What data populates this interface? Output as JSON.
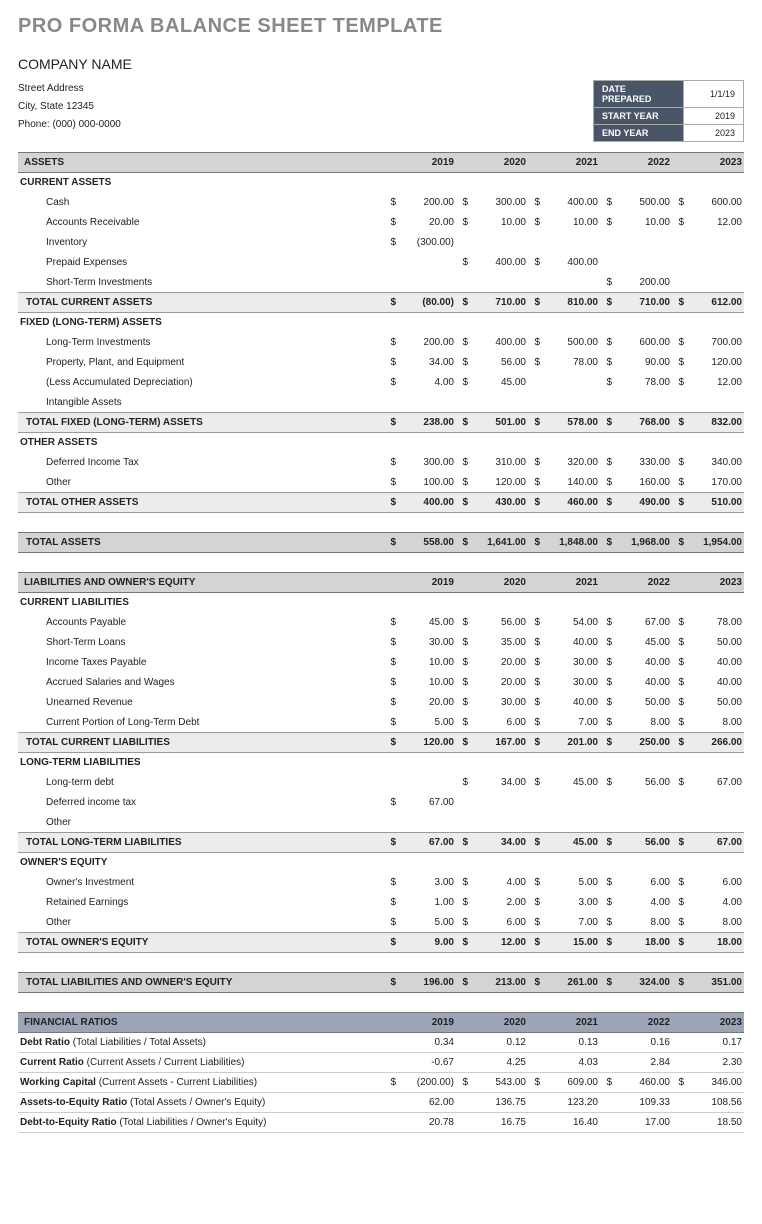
{
  "title": "PRO FORMA BALANCE SHEET TEMPLATE",
  "company": "COMPANY NAME",
  "addr": {
    "street": "Street Address",
    "city": "City, State  12345",
    "phone": "Phone: (000) 000-0000"
  },
  "dates": {
    "prep_lbl": "DATE PREPARED",
    "prep": "1/1/19",
    "sy_lbl": "START YEAR",
    "sy": "2019",
    "ey_lbl": "END YEAR",
    "ey": "2023"
  },
  "years": [
    "2019",
    "2020",
    "2021",
    "2022",
    "2023"
  ],
  "hdrs": {
    "assets": "ASSETS",
    "liab": "LIABILITIES AND OWNER'S EQUITY",
    "fin": "FINANCIAL RATIOS"
  },
  "sects": {
    "ca": "CURRENT ASSETS",
    "fa": "FIXED (LONG-TERM) ASSETS",
    "oa": "OTHER ASSETS",
    "cl": "CURRENT LIABILITIES",
    "ll": "LONG-TERM LIABILITIES",
    "oe": "OWNER'S EQUITY"
  },
  "rows": {
    "cash": {
      "n": "Cash",
      "v": [
        "200.00",
        "300.00",
        "400.00",
        "500.00",
        "600.00"
      ],
      "c": [
        1,
        1,
        1,
        1,
        1
      ]
    },
    "ar": {
      "n": "Accounts Receivable",
      "v": [
        "20.00",
        "10.00",
        "10.00",
        "10.00",
        "12.00"
      ],
      "c": [
        1,
        1,
        1,
        1,
        1
      ]
    },
    "inv": {
      "n": "Inventory",
      "v": [
        "(300.00)",
        "",
        "",
        "",
        ""
      ],
      "c": [
        1,
        0,
        0,
        0,
        0
      ]
    },
    "pre": {
      "n": "Prepaid Expenses",
      "v": [
        "",
        "400.00",
        "400.00",
        "",
        ""
      ],
      "c": [
        0,
        1,
        1,
        0,
        0
      ]
    },
    "sti": {
      "n": "Short-Term Investments",
      "v": [
        "",
        "",
        "",
        "200.00",
        ""
      ],
      "c": [
        0,
        0,
        0,
        1,
        0
      ]
    },
    "tca": {
      "n": "TOTAL CURRENT ASSETS",
      "v": [
        "(80.00)",
        "710.00",
        "810.00",
        "710.00",
        "612.00"
      ],
      "c": [
        1,
        1,
        1,
        1,
        1
      ]
    },
    "lti": {
      "n": "Long-Term Investments",
      "v": [
        "200.00",
        "400.00",
        "500.00",
        "600.00",
        "700.00"
      ],
      "c": [
        1,
        1,
        1,
        1,
        1
      ]
    },
    "ppe": {
      "n": "Property, Plant, and Equipment",
      "v": [
        "34.00",
        "56.00",
        "78.00",
        "90.00",
        "120.00"
      ],
      "c": [
        1,
        1,
        1,
        1,
        1
      ]
    },
    "dep": {
      "n": "(Less Accumulated Depreciation)",
      "v": [
        "4.00",
        "45.00",
        "",
        "78.00",
        "12.00"
      ],
      "c": [
        1,
        1,
        0,
        1,
        1
      ]
    },
    "ia": {
      "n": "Intangible Assets",
      "v": [
        "",
        "",
        "",
        "",
        ""
      ],
      "c": [
        0,
        0,
        0,
        0,
        0
      ]
    },
    "tfa": {
      "n": "TOTAL FIXED (LONG-TERM) ASSETS",
      "v": [
        "238.00",
        "501.00",
        "578.00",
        "768.00",
        "832.00"
      ],
      "c": [
        1,
        1,
        1,
        1,
        1
      ]
    },
    "dit": {
      "n": "Deferred Income Tax",
      "v": [
        "300.00",
        "310.00",
        "320.00",
        "330.00",
        "340.00"
      ],
      "c": [
        1,
        1,
        1,
        1,
        1
      ]
    },
    "oth": {
      "n": "Other",
      "v": [
        "100.00",
        "120.00",
        "140.00",
        "160.00",
        "170.00"
      ],
      "c": [
        1,
        1,
        1,
        1,
        1
      ]
    },
    "toa": {
      "n": "TOTAL OTHER ASSETS",
      "v": [
        "400.00",
        "430.00",
        "460.00",
        "490.00",
        "510.00"
      ],
      "c": [
        1,
        1,
        1,
        1,
        1
      ]
    },
    "ta": {
      "n": "TOTAL ASSETS",
      "v": [
        "558.00",
        "1,641.00",
        "1,848.00",
        "1,968.00",
        "1,954.00"
      ],
      "c": [
        1,
        1,
        1,
        1,
        1
      ]
    },
    "ap": {
      "n": "Accounts Payable",
      "v": [
        "45.00",
        "56.00",
        "54.00",
        "67.00",
        "78.00"
      ],
      "c": [
        1,
        1,
        1,
        1,
        1
      ]
    },
    "stl": {
      "n": "Short-Term Loans",
      "v": [
        "30.00",
        "35.00",
        "40.00",
        "45.00",
        "50.00"
      ],
      "c": [
        1,
        1,
        1,
        1,
        1
      ]
    },
    "itp": {
      "n": "Income Taxes Payable",
      "v": [
        "10.00",
        "20.00",
        "30.00",
        "40.00",
        "40.00"
      ],
      "c": [
        1,
        1,
        1,
        1,
        1
      ]
    },
    "asw": {
      "n": "Accrued Salaries and Wages",
      "v": [
        "10.00",
        "20.00",
        "30.00",
        "40.00",
        "40.00"
      ],
      "c": [
        1,
        1,
        1,
        1,
        1
      ]
    },
    "ur": {
      "n": "Unearned Revenue",
      "v": [
        "20.00",
        "30.00",
        "40.00",
        "50.00",
        "50.00"
      ],
      "c": [
        1,
        1,
        1,
        1,
        1
      ]
    },
    "cpl": {
      "n": "Current Portion of Long-Term Debt",
      "v": [
        "5.00",
        "6.00",
        "7.00",
        "8.00",
        "8.00"
      ],
      "c": [
        1,
        1,
        1,
        1,
        1
      ]
    },
    "tcl": {
      "n": "TOTAL CURRENT LIABILITIES",
      "v": [
        "120.00",
        "167.00",
        "201.00",
        "250.00",
        "266.00"
      ],
      "c": [
        1,
        1,
        1,
        1,
        1
      ]
    },
    "ltd": {
      "n": "Long-term debt",
      "v": [
        "",
        "34.00",
        "45.00",
        "56.00",
        "67.00"
      ],
      "c": [
        0,
        1,
        1,
        1,
        1
      ]
    },
    "dit2": {
      "n": "Deferred income tax",
      "v": [
        "67.00",
        "",
        "",
        "",
        ""
      ],
      "c": [
        1,
        0,
        0,
        0,
        0
      ]
    },
    "oth2": {
      "n": "Other",
      "v": [
        "",
        "",
        "",
        "",
        ""
      ],
      "c": [
        0,
        0,
        0,
        0,
        0
      ]
    },
    "tll": {
      "n": "TOTAL LONG-TERM LIABILITIES",
      "v": [
        "67.00",
        "34.00",
        "45.00",
        "56.00",
        "67.00"
      ],
      "c": [
        1,
        1,
        1,
        1,
        1
      ]
    },
    "oi": {
      "n": "Owner's Investment",
      "v": [
        "3.00",
        "4.00",
        "5.00",
        "6.00",
        "6.00"
      ],
      "c": [
        1,
        1,
        1,
        1,
        1
      ]
    },
    "re": {
      "n": "Retained Earnings",
      "v": [
        "1.00",
        "2.00",
        "3.00",
        "4.00",
        "4.00"
      ],
      "c": [
        1,
        1,
        1,
        1,
        1
      ]
    },
    "oth3": {
      "n": "Other",
      "v": [
        "5.00",
        "6.00",
        "7.00",
        "8.00",
        "8.00"
      ],
      "c": [
        1,
        1,
        1,
        1,
        1
      ]
    },
    "toe": {
      "n": "TOTAL OWNER'S EQUITY",
      "v": [
        "9.00",
        "12.00",
        "15.00",
        "18.00",
        "18.00"
      ],
      "c": [
        1,
        1,
        1,
        1,
        1
      ]
    },
    "tloe": {
      "n": "TOTAL LIABILITIES AND OWNER'S EQUITY",
      "v": [
        "196.00",
        "213.00",
        "261.00",
        "324.00",
        "351.00"
      ],
      "c": [
        1,
        1,
        1,
        1,
        1
      ]
    }
  },
  "ratios": {
    "dr": {
      "n": "Debt Ratio",
      "d": " (Total Liabilities / Total Assets)",
      "v": [
        "0.34",
        "0.12",
        "0.13",
        "0.16",
        "0.17"
      ],
      "c": [
        0,
        0,
        0,
        0,
        0
      ]
    },
    "cr": {
      "n": "Current Ratio",
      "d": " (Current Assets / Current Liabilities)",
      "v": [
        "-0.67",
        "4.25",
        "4.03",
        "2.84",
        "2.30"
      ],
      "c": [
        0,
        0,
        0,
        0,
        0
      ]
    },
    "wc": {
      "n": "Working Capital",
      "d": " (Current Assets - Current Liabilities)",
      "v": [
        "(200.00)",
        "543.00",
        "609.00",
        "460.00",
        "346.00"
      ],
      "c": [
        1,
        1,
        1,
        1,
        1
      ]
    },
    "ae": {
      "n": "Assets-to-Equity Ratio",
      "d": " (Total Assets / Owner's Equity)",
      "v": [
        "62.00",
        "136.75",
        "123.20",
        "109.33",
        "108.56"
      ],
      "c": [
        0,
        0,
        0,
        0,
        0
      ]
    },
    "de": {
      "n": "Debt-to-Equity Ratio",
      "d": " (Total Liabilities / Owner's Equity)",
      "v": [
        "20.78",
        "16.75",
        "16.40",
        "17.00",
        "18.50"
      ],
      "c": [
        0,
        0,
        0,
        0,
        0
      ]
    }
  }
}
